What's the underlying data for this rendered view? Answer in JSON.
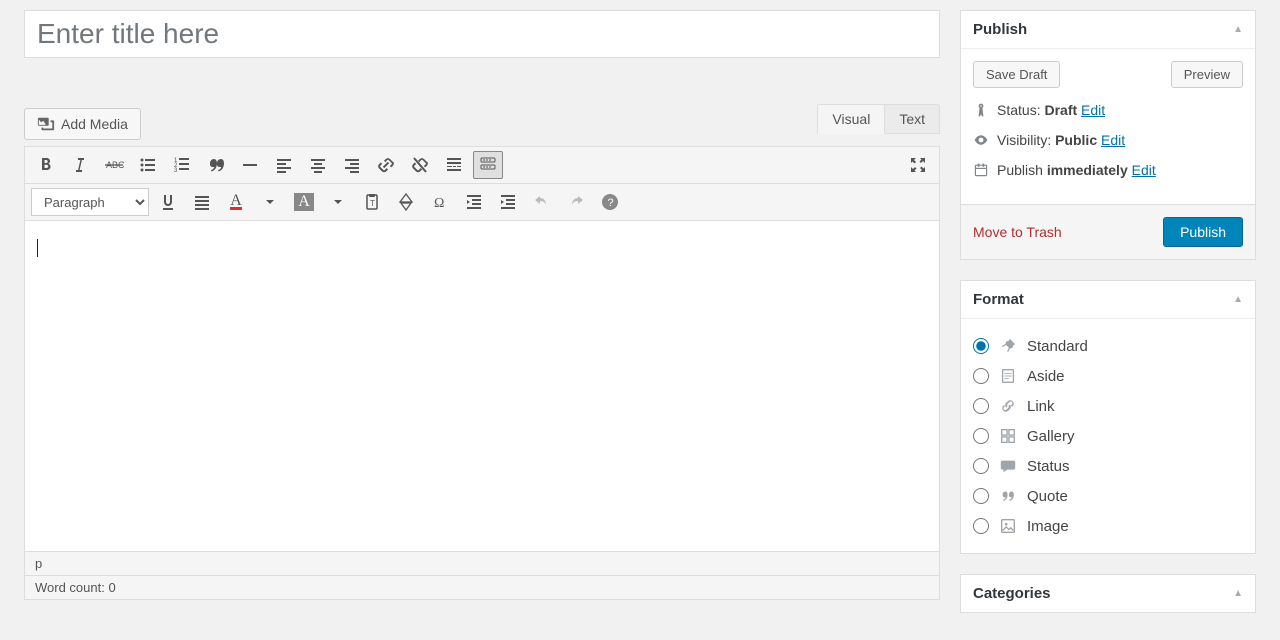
{
  "title": {
    "placeholder": "Enter title here",
    "value": ""
  },
  "addMedia": {
    "label": "Add Media"
  },
  "tabs": {
    "visual": "Visual",
    "text": "Text"
  },
  "toolbar": {
    "formatSelect": "Paragraph"
  },
  "editor": {
    "pathRow": "p",
    "wordCount": "Word count: 0"
  },
  "publishBox": {
    "title": "Publish",
    "saveDraft": "Save Draft",
    "preview": "Preview",
    "statusLabel": "Status:",
    "statusValue": "Draft",
    "visibilityLabel": "Visibility:",
    "visibilityValue": "Public",
    "publishLabel": "Publish",
    "publishValue": "immediately",
    "editLink": "Edit",
    "trash": "Move to Trash",
    "publishBtn": "Publish"
  },
  "formatBox": {
    "title": "Format",
    "items": [
      {
        "label": "Standard",
        "checked": true
      },
      {
        "label": "Aside",
        "checked": false
      },
      {
        "label": "Link",
        "checked": false
      },
      {
        "label": "Gallery",
        "checked": false
      },
      {
        "label": "Status",
        "checked": false
      },
      {
        "label": "Quote",
        "checked": false
      },
      {
        "label": "Image",
        "checked": false
      }
    ]
  },
  "categoriesBox": {
    "title": "Categories"
  }
}
